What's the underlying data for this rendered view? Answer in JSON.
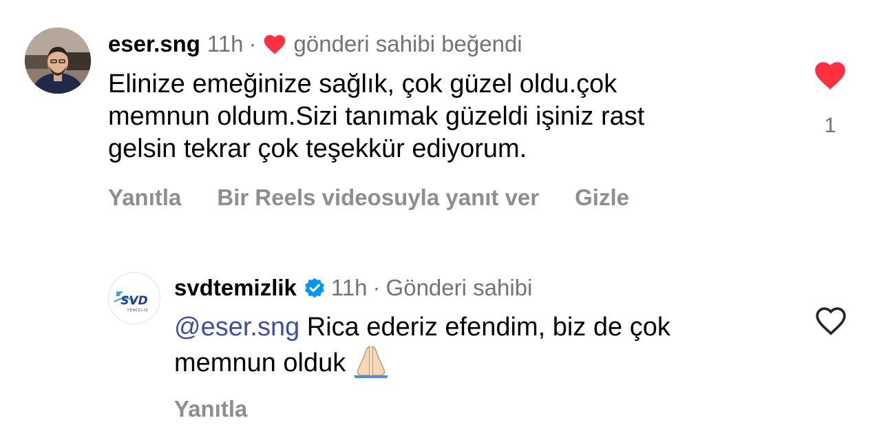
{
  "comment": {
    "username": "eser.sng",
    "time": "11h",
    "separator": "·",
    "liked_by_author_label": "gönderi sahibi beğendi",
    "text_lines": [
      "Elinize emeğinize sağlık, çok güzel oldu.çok",
      "memnun oldum.Sizi tanımak güzeldi işiniz rast",
      "gelsin tekrar çok teşekkür ediyorum."
    ],
    "actions": {
      "reply": "Yanıtla",
      "reels_reply": "Bir Reels videosuyla yanıt ver",
      "hide": "Gizle"
    },
    "like_count": "1",
    "liked": true,
    "like_color": "#ff3040"
  },
  "reply": {
    "username": "svdtemizlik",
    "verified": true,
    "verified_color": "#0095f6",
    "time": "11h",
    "separator": "·",
    "author_label": "Gönderi sahibi",
    "mention": "@eser.sng",
    "text_line1_rest": " Rica ederiz efendim, biz de çok",
    "text_line2": "memnun olduk",
    "emoji": "folded-hands",
    "actions": {
      "reply": "Yanıtla"
    },
    "liked": false,
    "avatar_logo_text": "SVD",
    "avatar_logo_subtext": "TEMİZLİK"
  }
}
